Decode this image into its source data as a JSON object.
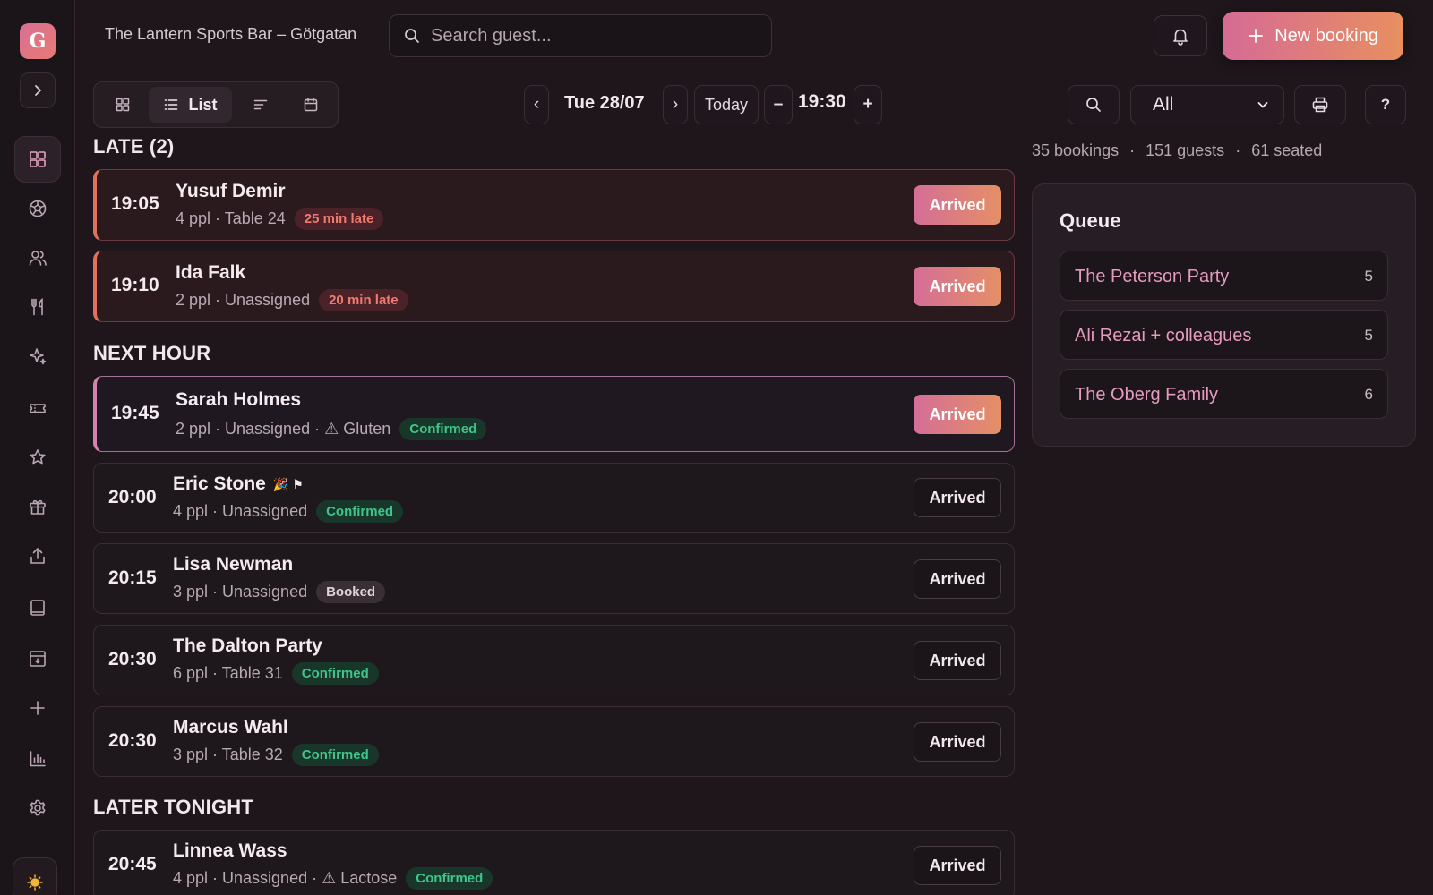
{
  "app": {
    "logo_letter": "G",
    "venue": "The Lantern Sports Bar – Götgatan",
    "accent_gradient": [
      "#d56b95",
      "#e88f60"
    ]
  },
  "header": {
    "search_placeholder": "Search guest...",
    "new_booking_label": "New booking"
  },
  "toolbar": {
    "list_label": "List",
    "date": "Tue 28/07",
    "today_label": "Today",
    "minus": "–",
    "plus": "+",
    "time": "19:30",
    "prev": "‹",
    "next": "›",
    "filter_value": "All",
    "filter_options": [
      "All"
    ],
    "help": "?"
  },
  "sections": {
    "late": "LATE (2)",
    "next_hour": "NEXT HOUR",
    "later_tonight": "LATER TONIGHT"
  },
  "bookings": [
    {
      "time": "19:05",
      "name": "Yusuf Demir",
      "meta": "4 ppl · Table 24",
      "badge": "25 min late",
      "action": "Arrived"
    },
    {
      "time": "19:10",
      "name": "Ida Falk",
      "meta": "2 ppl · Unassigned",
      "badge": "20 min late",
      "action": "Arrived"
    },
    {
      "time": "19:45",
      "name": "Sarah Holmes",
      "meta": "2 ppl · Unassigned · ⚠ Gluten",
      "badge": "Confirmed",
      "action": "Arrived"
    },
    {
      "time": "20:00",
      "name": "Eric Stone",
      "meta": "4 ppl · Unassigned",
      "badge": "Confirmed",
      "action": "Arrived",
      "icons": "🎉 ⚑"
    },
    {
      "time": "20:15",
      "name": "Lisa Newman",
      "meta": "3 ppl · Unassigned",
      "badge": "Booked",
      "action": "Arrived"
    },
    {
      "time": "20:30",
      "name": "The Dalton Party",
      "meta": "6 ppl · Table 31",
      "badge": "Confirmed",
      "action": "Arrived"
    },
    {
      "time": "20:30",
      "name": "Marcus Wahl",
      "meta": "3 ppl · Table 32",
      "badge": "Confirmed",
      "action": "Arrived"
    },
    {
      "time": "20:45",
      "name": "Linnea Wass",
      "meta": "4 ppl · Unassigned · ⚠ Lactose",
      "badge": "Confirmed",
      "action": "Arrived"
    }
  ],
  "stats": {
    "bookings": "35 bookings",
    "guests": "151 guests",
    "seated": "61 seated",
    "sep": "·"
  },
  "queue": {
    "title": "Queue",
    "items": [
      {
        "name": "The Peterson Party",
        "count": "5"
      },
      {
        "name": "Ali Rezai + colleagues",
        "count": "5"
      },
      {
        "name": "The Oberg Family",
        "count": "6"
      }
    ]
  },
  "sidebar": {
    "items": [
      "dashboard-icon",
      "football-icon",
      "users-icon",
      "cutlery-icon",
      "sparkle-icon",
      "ticket-icon",
      "star-icon",
      "gift-icon",
      "upload-icon",
      "book-icon",
      "archive-icon",
      "plus-icon",
      "chart-icon",
      "settings-icon"
    ],
    "theme_icon": "sun-icon"
  }
}
